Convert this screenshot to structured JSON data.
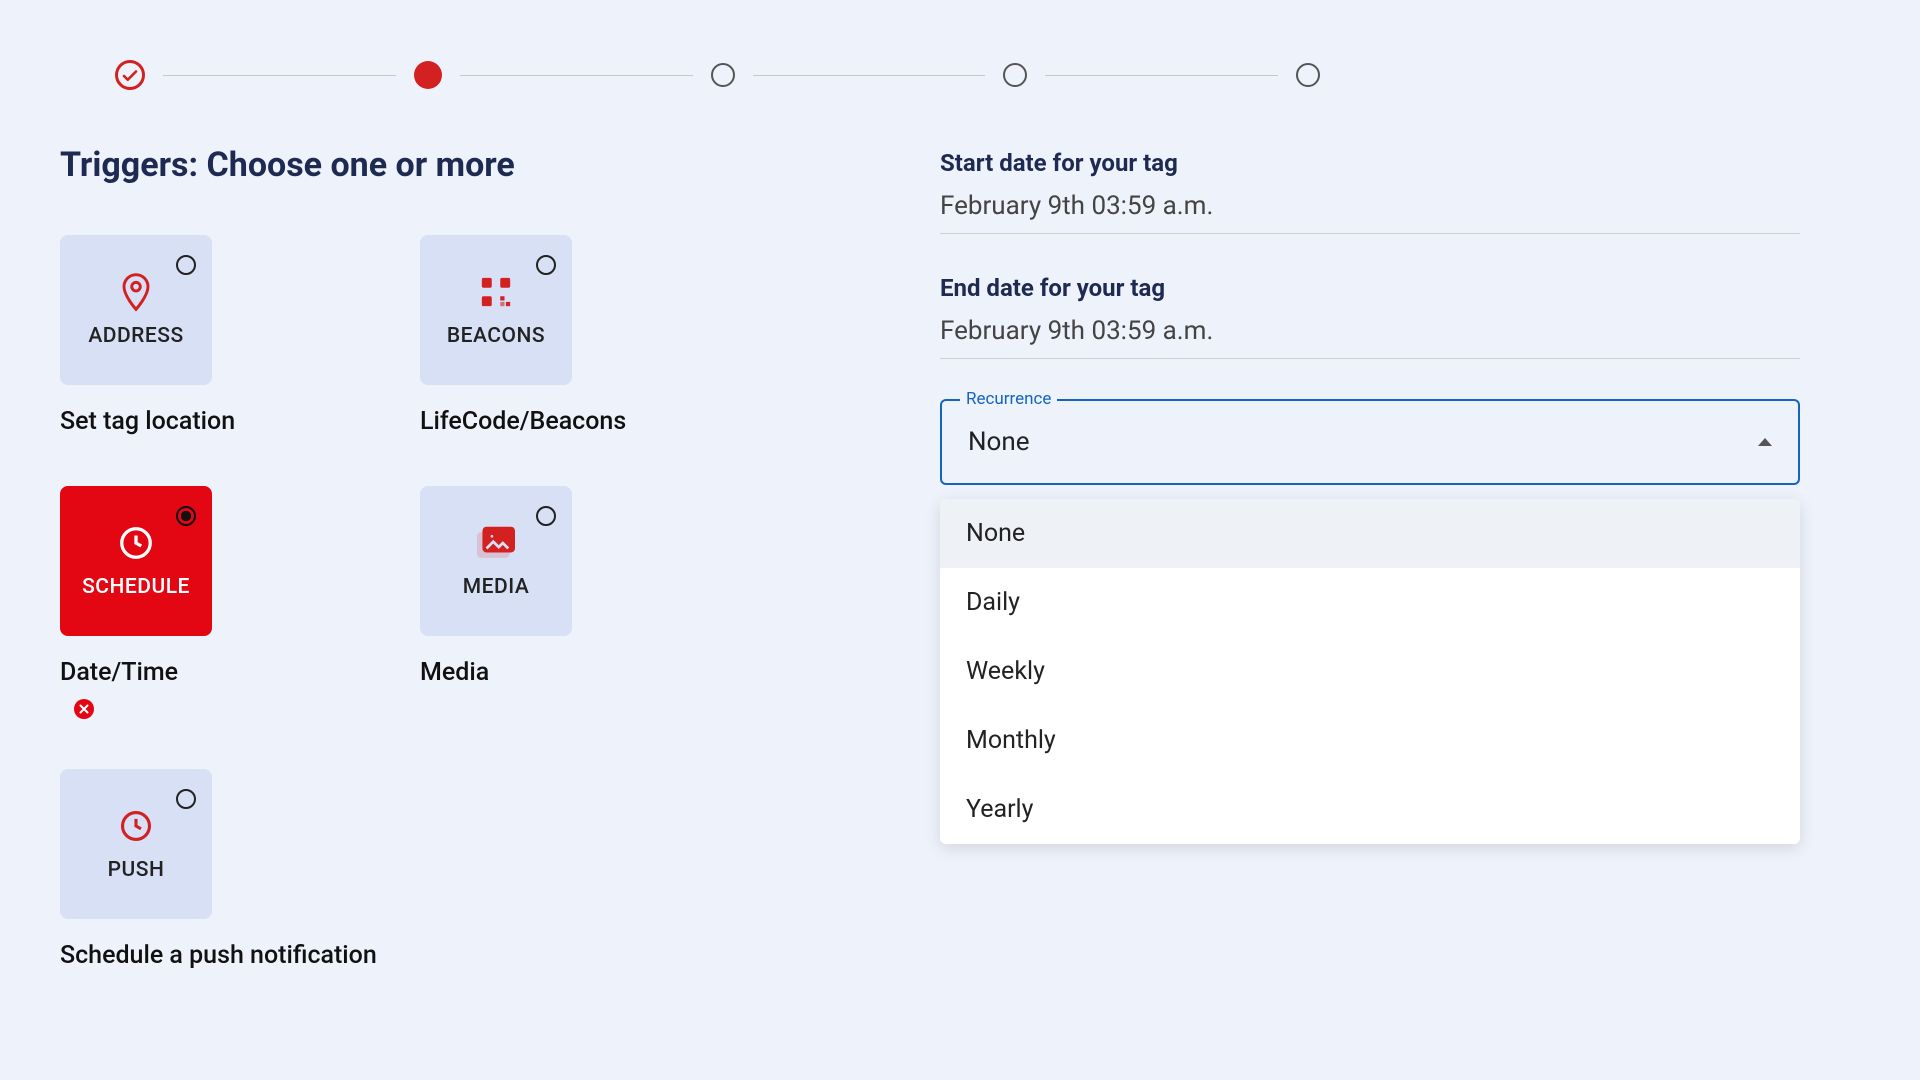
{
  "heading": "Triggers: Choose one or more",
  "triggers": {
    "address": {
      "card_label": "ADDRESS",
      "desc": "Set tag location"
    },
    "beacons": {
      "card_label": "BEACONS",
      "desc": "LifeCode/Beacons"
    },
    "schedule": {
      "card_label": "SCHEDULE",
      "desc": "Date/Time"
    },
    "media": {
      "card_label": "MEDIA",
      "desc": "Media"
    },
    "push": {
      "card_label": "PUSH",
      "desc": "Schedule a push notification"
    }
  },
  "right": {
    "start_label": "Start date for your tag",
    "start_value": "February 9th 03:59 a.m.",
    "end_label": "End date for your tag",
    "end_value": "February 9th 03:59 a.m.",
    "recurrence_label": "Recurrence",
    "recurrence_value": "None",
    "recurrence_options": {
      "none": "None",
      "daily": "Daily",
      "weekly": "Weekly",
      "monthly": "Monthly",
      "yearly": "Yearly"
    }
  }
}
